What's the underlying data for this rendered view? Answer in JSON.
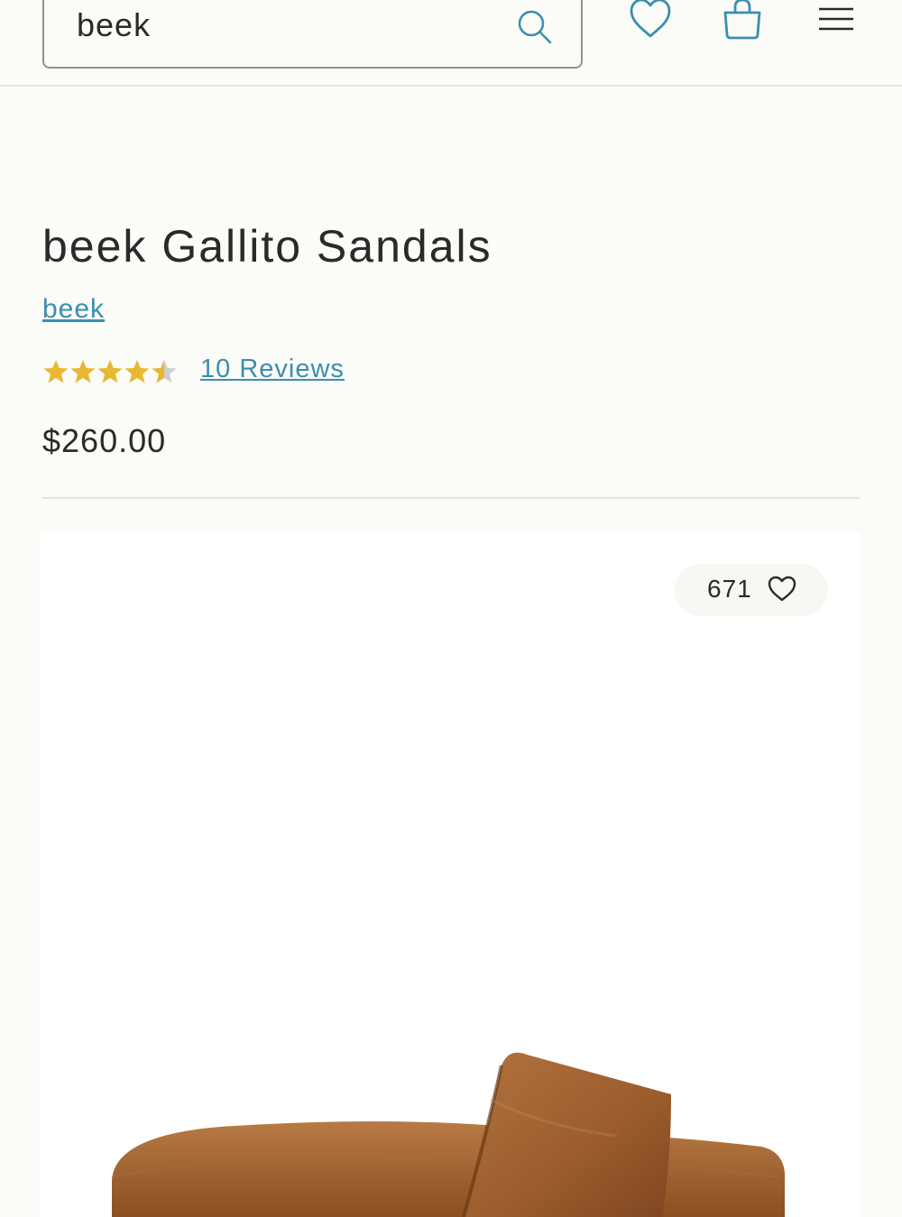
{
  "header": {
    "search": {
      "value": "beek",
      "placeholder": ""
    },
    "icons": [
      "search-icon",
      "heart-icon",
      "shopping-bag-icon",
      "hamburger-menu-icon"
    ]
  },
  "product": {
    "title": "beek Gallito Sandals",
    "brand": "beek",
    "rating": 4.5,
    "rating_max": 5,
    "reviews_label": "10 Reviews",
    "price": "$260.00",
    "favorites_count": "671",
    "image_alt": "beek Gallito Sandals"
  },
  "colors": {
    "accent": "#3b8fae",
    "star": "#e8b830",
    "star_empty": "#cfcfcf",
    "text": "#2a2a2a",
    "background": "#fbfbf7",
    "leather": "#9a5c2c"
  }
}
